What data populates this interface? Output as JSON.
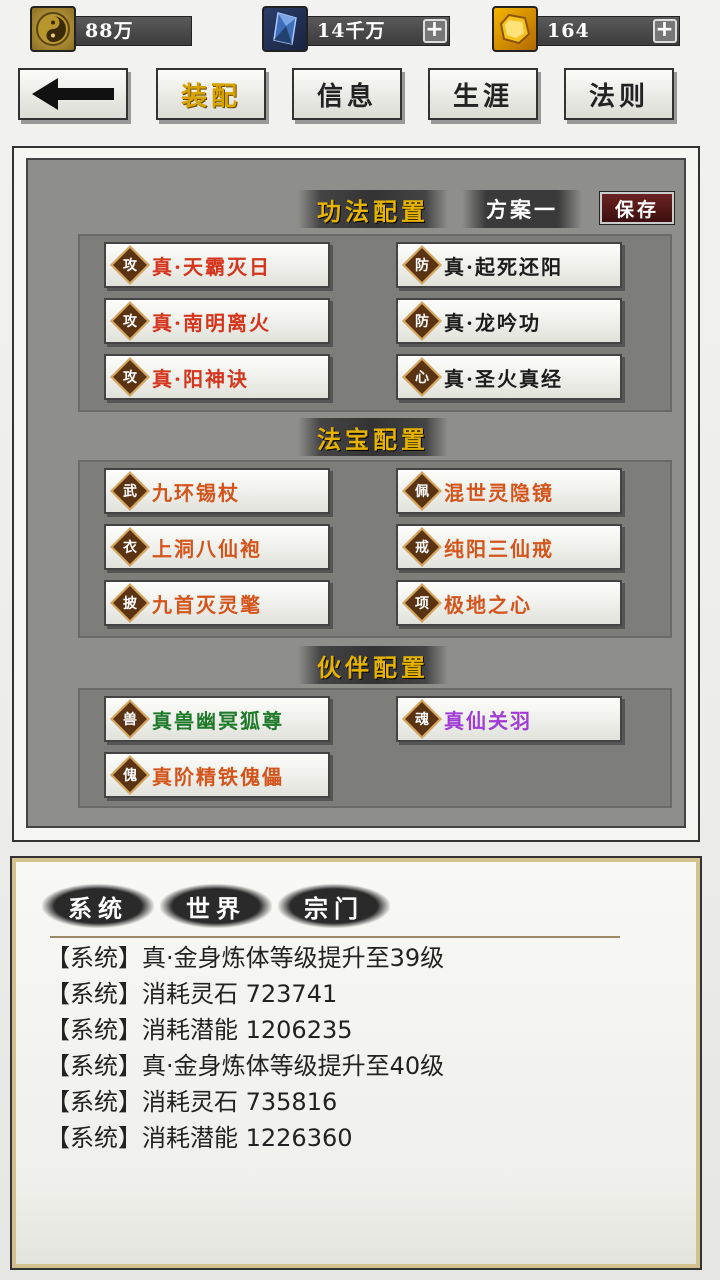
{
  "resources": [
    {
      "icon": "yin-yang-coin-icon",
      "value": "88万",
      "has_plus": false
    },
    {
      "icon": "blue-crystal-icon",
      "value": "14千万",
      "has_plus": true
    },
    {
      "icon": "gold-gem-icon",
      "value": "164",
      "has_plus": true
    }
  ],
  "plus_label": "+",
  "tabs": {
    "back": "←",
    "equip": "装配",
    "info": "信息",
    "career": "生涯",
    "law": "法则"
  },
  "panel": {
    "skills_title": "功法配置",
    "plan_label": "方案一",
    "save_label": "保存",
    "treasure_title": "法宝配置",
    "partner_title": "伙伴配置"
  },
  "skills": [
    {
      "badge": "攻",
      "name": "真·天霸灭日",
      "color": "#d4351c"
    },
    {
      "badge": "防",
      "name": "真·起死还阳",
      "color": "#1c1c1c"
    },
    {
      "badge": "攻",
      "name": "真·南明离火",
      "color": "#d4351c"
    },
    {
      "badge": "防",
      "name": "真·龙吟功",
      "color": "#1c1c1c"
    },
    {
      "badge": "攻",
      "name": "真·阳神诀",
      "color": "#d4351c"
    },
    {
      "badge": "心",
      "name": "真·圣火真经",
      "color": "#1c1c1c"
    }
  ],
  "treasures": [
    {
      "badge": "武",
      "name": "九环锡杖",
      "color": "#d4551c"
    },
    {
      "badge": "佩",
      "name": "混世灵隐镜",
      "color": "#d4551c"
    },
    {
      "badge": "衣",
      "name": "上洞八仙袍",
      "color": "#d4551c"
    },
    {
      "badge": "戒",
      "name": "纯阳三仙戒",
      "color": "#d4551c"
    },
    {
      "badge": "披",
      "name": "九首灭灵氅",
      "color": "#d4551c"
    },
    {
      "badge": "项",
      "name": "极地之心",
      "color": "#d4551c"
    }
  ],
  "partners": [
    {
      "badge": "兽",
      "name": "真兽幽冥狐尊",
      "color": "#1f7a2a"
    },
    {
      "badge": "魂",
      "name": "真仙关羽",
      "color": "#a03bd6"
    },
    {
      "badge": "傀",
      "name": "真阶精铁傀儡",
      "color": "#d4551c"
    }
  ],
  "chat": {
    "tabs": [
      "系统",
      "世界",
      "宗门"
    ],
    "messages": [
      "【系统】真·金身炼体等级提升至39级",
      "【系统】消耗灵石 723741",
      "【系统】消耗潜能 1206235",
      "【系统】真·金身炼体等级提升至40级",
      "【系统】消耗灵石 735816",
      "【系统】消耗潜能 1226360"
    ]
  }
}
